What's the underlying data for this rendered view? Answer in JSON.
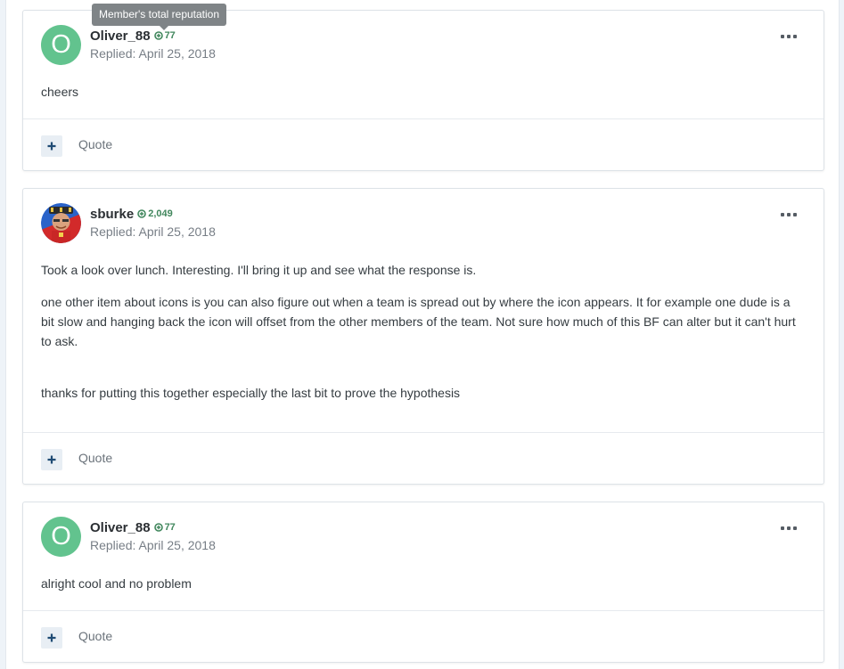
{
  "tooltip": "Member's total reputation",
  "quote_label": "Quote",
  "posts": [
    {
      "author": "Oliver_88",
      "avatar_letter": "O",
      "reputation": "77",
      "date": "Replied: April 25, 2018",
      "body": [
        "cheers"
      ]
    },
    {
      "author": "sburke",
      "reputation": "2,049",
      "date": "Replied: April 25, 2018",
      "body": [
        "Took a look over lunch.  Interesting.  I'll bring it up and see what the response is.",
        "one other item about icons is you can also figure out when a team is spread out by where the icon appears.  It for example one dude is a bit slow and hanging back the icon will offset from the other members of the team.  Not sure how much of this BF can alter but it can't hurt to ask.",
        "thanks for putting this together especially the last bit to prove the hypothesis"
      ]
    },
    {
      "author": "Oliver_88",
      "avatar_letter": "O",
      "reputation": "77",
      "date": "Replied: April 25, 2018",
      "body": [
        "alright cool and no problem"
      ]
    }
  ],
  "colors": {
    "avatar_green": "#62c38e",
    "reputation_green": "#41875d",
    "tooltip_bg": "#7f8487"
  },
  "icons": [
    "reputation-plus-icon",
    "more-options-icon",
    "multiquote-plus-icon"
  ]
}
